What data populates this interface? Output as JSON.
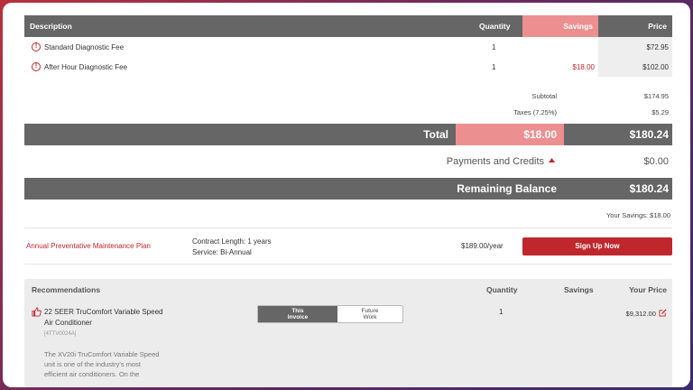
{
  "table": {
    "headers": {
      "description": "Description",
      "quantity": "Quantity",
      "savings": "Savings",
      "price": "Price"
    },
    "rows": [
      {
        "description": "Standard Diagnostic Fee",
        "quantity": "1",
        "savings": "",
        "price": "$72.95"
      },
      {
        "description": "After Hour Diagnostic Fee",
        "quantity": "1",
        "savings": "$18.00",
        "price": "$102.00"
      }
    ]
  },
  "summary": {
    "subtotal_label": "Subtotal",
    "subtotal_value": "$174.95",
    "taxes_label": "Taxes (7.25%)",
    "taxes_value": "$5.29",
    "total_label": "Total",
    "total_savings": "$18.00",
    "total_value": "$180.24",
    "payments_label": "Payments and Credits",
    "payments_value": "$0.00",
    "remaining_label": "Remaining Balance",
    "remaining_value": "$180.24",
    "your_savings": "Your Savings: $18.00"
  },
  "plan": {
    "name": "Annual Preventative Maintenance Plan",
    "contract": "Contract Length: 1 years",
    "service": "Service: Bi-Annual",
    "price": "$189.00/year",
    "signup_label": "Sign Up Now"
  },
  "recommendations": {
    "headers": {
      "title": "Recommendations",
      "quantity": "Quantity",
      "savings": "Savings",
      "your_price": "Your Price"
    },
    "item": {
      "title_line1": "22 SEER TruComfort Variable Speed",
      "title_line2": "Air Conditioner",
      "sku": "[4TTV0024A]",
      "toggle_this_1": "This",
      "toggle_this_2": "Invoice",
      "toggle_future_1": "Future",
      "toggle_future_2": "Work",
      "quantity": "1",
      "price": "$9,312.00",
      "description_1": "The XV20i TruComfort Variable Speed",
      "description_2": "unit is one of the industry's most",
      "description_3": "efficient air conditioners. On the"
    }
  },
  "colors": {
    "accent": "#c0272d",
    "header_bg": "#666666",
    "savings_bg": "#ec8f90"
  }
}
